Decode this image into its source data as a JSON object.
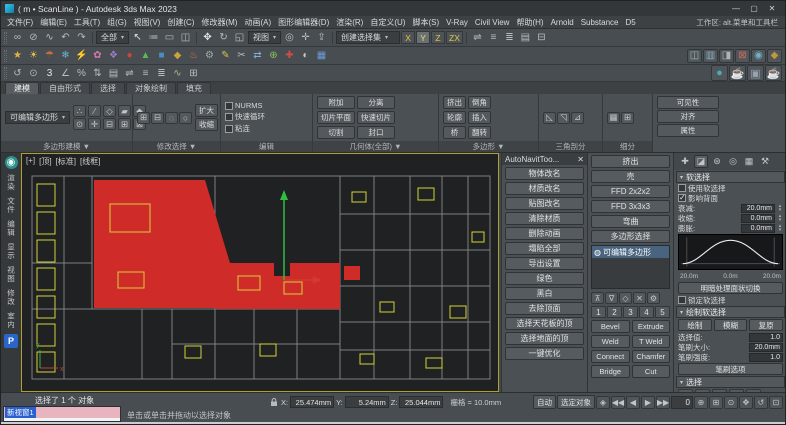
{
  "colors": {
    "accent_red": "#cf2b28",
    "accent_yellow": "#d6d23a",
    "viewport_bg": "#1f2123",
    "selection_blue": "#2a5fd0"
  },
  "window": {
    "title": "( m • ScanLine ) - Autodesk 3ds Max 2023",
    "controls": {
      "min": "—",
      "max": "▢",
      "close": "✕"
    }
  },
  "menubar": {
    "items": [
      "文件(F)",
      "编辑(E)",
      "工具(T)",
      "组(G)",
      "视图(V)",
      "创建(C)",
      "修改器(M)",
      "动画(A)",
      "图形编辑器(D)",
      "渲染(R)",
      "自定义(U)",
      "脚本(S)",
      "V-Ray",
      "Civil View",
      "帮助(H)",
      "Arnold",
      "Substance",
      "D5"
    ],
    "workspace": "工作区: alt.菜单和工具栏"
  },
  "toolbar1": {
    "left_icons": [
      {
        "n": "select-and-link-icon",
        "g": "∞",
        "c": "#b8bcbe"
      },
      {
        "n": "unlink-selection-icon",
        "g": "⊘",
        "c": "#b8bcbe"
      },
      {
        "n": "bind-to-spacewarp-icon",
        "g": "∿",
        "c": "#b8bcbe"
      },
      {
        "n": "undo-icon",
        "g": "↶",
        "c": "#b8bcbe"
      },
      {
        "n": "redo-icon",
        "g": "↷",
        "c": "#b8bcbe"
      }
    ],
    "filter": "全部",
    "select_icons": [
      {
        "n": "select-object-icon",
        "g": "↖",
        "c": "#e0e2e3"
      },
      {
        "n": "select-by-name-icon",
        "g": "≔",
        "c": "#b8bcbe"
      },
      {
        "n": "rect-selection-region-icon",
        "g": "▭",
        "c": "#b8bcbe"
      },
      {
        "n": "window-crossing-icon",
        "g": "◫",
        "c": "#b8bcbe"
      }
    ],
    "transform_icons": [
      {
        "n": "select-and-move-icon",
        "g": "✥",
        "c": "#e0e2e3"
      },
      {
        "n": "select-and-rotate-icon",
        "g": "↻",
        "c": "#b8bcbe"
      },
      {
        "n": "select-and-scale-icon",
        "g": "◱",
        "c": "#b8bcbe"
      }
    ],
    "refcoord": "视图",
    "pivot_icons": [
      {
        "n": "use-pivot-center-icon",
        "g": "◎",
        "c": "#b8bcbe"
      },
      {
        "n": "select-and-manipulate-icon",
        "g": "✛",
        "c": "#b8bcbe"
      },
      {
        "n": "keyboard-override-icon",
        "g": "⇪",
        "c": "#b8bcbe"
      }
    ],
    "named_sets": "创建选择集",
    "axis": [
      {
        "label": "X"
      },
      {
        "label": "Y",
        "cls": "on"
      },
      {
        "label": "Z"
      },
      {
        "label": "ZX"
      }
    ],
    "right_icons": [
      {
        "n": "mirror-icon",
        "g": "⇌",
        "c": "#b8bcbe"
      },
      {
        "n": "align-icon",
        "g": "≡",
        "c": "#b8bcbe"
      },
      {
        "n": "layer-manager-icon",
        "g": "≣",
        "c": "#b8bcbe"
      },
      {
        "n": "ribbon-toggle-icon",
        "g": "▤",
        "c": "#b8bcbe"
      },
      {
        "n": "scene-explorer-icon",
        "g": "⊟",
        "c": "#b8bcbe"
      }
    ]
  },
  "toolbar2": {
    "icons": [
      {
        "n": "star-tool-icon",
        "g": "★",
        "c": "#e0b340"
      },
      {
        "n": "sun-tool-icon",
        "g": "☀",
        "c": "#e6c84c"
      },
      {
        "n": "umbrella-tool-icon",
        "g": "☂",
        "c": "#d06a3c"
      },
      {
        "n": "snowflake-tool-icon",
        "g": "❄",
        "c": "#6cb6da"
      },
      {
        "n": "lightning-tool-icon",
        "g": "⚡",
        "c": "#e8d44e"
      },
      {
        "n": "flower-tool-icon",
        "g": "✿",
        "c": "#d878a8"
      },
      {
        "n": "ornament-tool-icon",
        "g": "❖",
        "c": "#9c7ccc"
      },
      {
        "n": "circle-tool-icon",
        "g": "●",
        "c": "#cc4538"
      },
      {
        "n": "triangle-tool-icon",
        "g": "▲",
        "c": "#5aba5a"
      },
      {
        "n": "square-tool-icon",
        "g": "■",
        "c": "#4c8aca"
      },
      {
        "n": "diamond-tool-icon",
        "g": "◆",
        "c": "#c8a23c"
      },
      {
        "n": "hotspring-tool-icon",
        "g": "♨",
        "c": "#d87a4a"
      },
      {
        "n": "gear-tool-icon",
        "g": "⚙",
        "c": "#a2a8ac"
      },
      {
        "n": "pencil-tool-icon",
        "g": "✎",
        "c": "#d8c24c"
      },
      {
        "n": "scissors-tool-icon",
        "g": "✂",
        "c": "#b8bcbf"
      },
      {
        "n": "swap-arrows-tool-icon",
        "g": "⇄",
        "c": "#7cb2da"
      },
      {
        "n": "plus-circle-tool-icon",
        "g": "⊕",
        "c": "#8ac25a"
      },
      {
        "n": "plus-tool-icon",
        "g": "✚",
        "c": "#d24a4a"
      },
      {
        "n": "half-circle-tool-icon",
        "g": "◐",
        "c": "#c9c9c9"
      },
      {
        "n": "grid-tool-icon",
        "g": "▦",
        "c": "#6c9cda"
      }
    ],
    "right_icons": [
      {
        "n": "panel-a-icon",
        "g": "◫",
        "c": "#9ab0bc"
      },
      {
        "n": "panel-b-icon",
        "g": "▥",
        "c": "#8aaec0"
      },
      {
        "n": "panel-c-icon",
        "g": "◨",
        "c": "#aab4ba"
      },
      {
        "n": "panel-d-icon",
        "g": "⊠",
        "c": "#cc6a5a"
      },
      {
        "n": "panel-e-icon",
        "g": "◉",
        "c": "#6cb4c8"
      },
      {
        "n": "panel-f-icon",
        "g": "◆",
        "c": "#c09a3a"
      }
    ]
  },
  "toolbar3": {
    "left_icons": [
      {
        "n": "arc-rotate-icon",
        "g": "↺",
        "c": "#b8bcbe"
      },
      {
        "n": "isolate-selection-icon",
        "g": "⊙",
        "c": "#b8bcbe"
      },
      {
        "n": "snap-toggle-3d-icon",
        "g": "3",
        "c": "#e4e5e6"
      },
      {
        "n": "angle-snap-icon",
        "g": "∠",
        "c": "#b8bcbe"
      },
      {
        "n": "percent-snap-icon",
        "g": "%",
        "c": "#b8bcbe"
      },
      {
        "n": "spinner-snap-icon",
        "g": "⇅",
        "c": "#b8bcbe"
      },
      {
        "n": "edit-named-sets-icon",
        "g": "▤",
        "c": "#b8bcbe"
      },
      {
        "n": "mirror-tool-icon",
        "g": "⇌",
        "c": "#b8bcbe"
      },
      {
        "n": "align-tool-icon",
        "g": "≡",
        "c": "#b8bcbe"
      },
      {
        "n": "layer-explorer-icon",
        "g": "≣",
        "c": "#b8bcbe"
      },
      {
        "n": "curve-editor-icon",
        "g": "∿",
        "c": "#9cc27c"
      },
      {
        "n": "schematic-view-icon",
        "g": "⊞",
        "c": "#b8bcbe"
      }
    ],
    "right_icons": [
      {
        "n": "material-editor-icon",
        "g": "●",
        "c": "#46aab8"
      },
      {
        "n": "render-setup-icon",
        "g": "☕",
        "c": "#7cb6ca"
      },
      {
        "n": "rendered-frame-icon",
        "g": "▣",
        "c": "#96a2ac"
      },
      {
        "n": "render-production-icon",
        "g": "☕",
        "c": "#5c9aca"
      }
    ]
  },
  "ribbon": {
    "tabs": [
      {
        "label": "建模",
        "cls": "active"
      },
      {
        "label": "自由形式"
      },
      {
        "label": "选择"
      },
      {
        "label": "对象绘制"
      },
      {
        "label": "填充"
      }
    ],
    "poly_modeling": {
      "dropdown": "可编辑多边形",
      "icons": [
        {
          "n": "vertex-subobject-icon",
          "g": "∴"
        },
        {
          "n": "edge-subobject-icon",
          "g": "∕"
        },
        {
          "n": "border-subobject-icon",
          "g": "◇"
        },
        {
          "n": "polygon-subobject-icon",
          "g": "▰"
        },
        {
          "n": "element-subobject-icon",
          "g": "◆"
        },
        {
          "n": "preview-subobject-icon",
          "g": "⊙"
        },
        {
          "n": "pivot-toggle-icon",
          "g": "✛"
        },
        {
          "n": "collapse-icon",
          "g": "⊟"
        },
        {
          "n": "attach-small-icon",
          "g": "⊞"
        },
        {
          "n": "detach-small-icon",
          "g": "⊠"
        }
      ],
      "footer": "多边形建模 ▼"
    },
    "modify_selection": {
      "icons": [
        {
          "n": "grow-selection-icon",
          "g": "⊞"
        },
        {
          "n": "shrink-selection-icon",
          "g": "⊟"
        },
        {
          "n": "loop-selection-icon",
          "g": "◌"
        },
        {
          "n": "ring-selection-icon",
          "g": "○"
        }
      ],
      "buttons": [
        "扩大",
        "收缩"
      ],
      "footer": "修改选择 ▼"
    },
    "edit": {
      "toggles": [
        "NURMS",
        "快速循环",
        "粘连"
      ],
      "footer": "编辑"
    },
    "geometry": {
      "buttons": [
        "附加",
        "分离",
        "切片平面",
        "快速切片",
        "切割",
        "封口"
      ],
      "footer": "几何体(全部) ▼"
    },
    "polygons": {
      "buttons": [
        "挤出",
        "倒角",
        "轮廓",
        "插入",
        "桥",
        "翻转"
      ],
      "footer": "多边形 ▼"
    },
    "triangulation": {
      "icons": [
        {
          "n": "triangulate-icon",
          "g": "◺"
        },
        {
          "n": "retriangulate-icon",
          "g": "◹"
        },
        {
          "n": "edit-triangulation-icon",
          "g": "⊿"
        }
      ],
      "footer": "三角剖分"
    },
    "subdivision": {
      "icons": [
        {
          "n": "meshsmooth-icon",
          "g": "▦"
        },
        {
          "n": "tessellate-icon",
          "g": "⊞"
        }
      ],
      "footer": "细分"
    },
    "right_buttons": [
      "可见性",
      "对齐",
      "属性"
    ]
  },
  "left_dock": {
    "labels": [
      "渲染",
      "文件",
      "编辑",
      "显示",
      "视图",
      "修改",
      "室内"
    ],
    "p_badge": "P"
  },
  "viewport": {
    "menus": [
      "[+]",
      "[顶]",
      "[标准]",
      "[线框]"
    ],
    "axis_x": "x",
    "axis_y": "y"
  },
  "plugin_panel": {
    "title": "AutoNavitToo...",
    "buttons": [
      "物体改名",
      "材质改名",
      "贴图改名",
      "清除材质",
      "删除动画",
      "塌陷全部",
      "导出设置",
      "绿色",
      "黑白",
      "去除顶面",
      "选择天花板的顶",
      "选择地面的顶",
      "一键优化"
    ]
  },
  "modifier_panel": {
    "buttons": [
      "挤出",
      "壳",
      "FFD 2x2x2",
      "FFD 3x3x3",
      "弯曲",
      "多边形选择"
    ],
    "bulb": "◍",
    "stack_item": "可编辑多边形",
    "stack_tools": [
      {
        "n": "pin-stack-icon",
        "g": "⊼"
      },
      {
        "n": "show-end-result-icon",
        "g": "∇"
      },
      {
        "n": "make-unique-icon",
        "g": "◇"
      },
      {
        "n": "remove-modifier-icon",
        "g": "✕"
      },
      {
        "n": "configure-sets-icon",
        "g": "⚙"
      }
    ],
    "levels": [
      "1",
      "2",
      "3",
      "4",
      "5"
    ],
    "pairs": [
      {
        "a": "Bevel",
        "b": "Extrude"
      },
      {
        "a": "Weld",
        "b": "T Weld"
      },
      {
        "a": "Connect",
        "b": "Chamfer"
      },
      {
        "a": "Bridge",
        "b": "Cut"
      }
    ]
  },
  "command_panel": {
    "tabs": [
      {
        "n": "create-tab-icon",
        "g": "✚"
      },
      {
        "n": "modify-tab-icon",
        "g": "◪",
        "cls": "active"
      },
      {
        "n": "hierarchy-tab-icon",
        "g": "⊛"
      },
      {
        "n": "motion-tab-icon",
        "g": "◎"
      },
      {
        "n": "display-tab-icon",
        "g": "▦"
      },
      {
        "n": "utilities-tab-icon",
        "g": "⚒"
      }
    ],
    "soft_selection": {
      "header": "软选择",
      "use": "使用软选择",
      "affect_backfacing": "影响背面",
      "falloff_label": "衰减:",
      "falloff": "20.0mm",
      "pinch_label": "收缩:",
      "pinch": "0.0mm",
      "bubble_label": "膨胀:",
      "bubble": "0.0mm",
      "scale_labels": [
        "20.0m",
        "0.0m",
        "20.0m"
      ],
      "shaded_button": "明暗处理面状切换",
      "lock": "锁定软选择"
    },
    "paint": {
      "header": "绘制软选择",
      "buttons": [
        "绘制",
        "模糊",
        "复原"
      ],
      "sel_label": "选择值:",
      "sel": "1.0",
      "size_label": "笔刷大小:",
      "size": "20.0mm",
      "strength_label": "笔刷强度:",
      "strength": "1.0",
      "options": "笔刷选项"
    },
    "selection": {
      "header": "选择",
      "icons": [
        {
          "n": "vertex-level-icon",
          "g": "∴"
        },
        {
          "n": "edge-level-icon",
          "g": "∕"
        },
        {
          "n": "border-level-icon",
          "g": "◇"
        },
        {
          "n": "polygon-level-icon",
          "g": "▰"
        },
        {
          "n": "element-level-icon",
          "g": "◆"
        }
      ]
    }
  },
  "status": {
    "listener_selected": "新视窗1",
    "line1": "选择了 1 个 对象",
    "line2": "单击或单击并拖动以选择对象",
    "x_label": "X:",
    "x": "25.474mm",
    "y_label": "Y:",
    "y": "5.24mm",
    "z_label": "Z:",
    "z": "25.044mm",
    "grid": "栅格 = 10.0mm",
    "auto": "自动",
    "sel_mode": "选定对象",
    "key_icon": "◈",
    "time": "0",
    "playback": [
      {
        "n": "go-to-start-icon",
        "g": "◀◀"
      },
      {
        "n": "previous-frame-icon",
        "g": "◀"
      },
      {
        "n": "play-icon",
        "g": "▶"
      },
      {
        "n": "go-to-end-icon",
        "g": "▶▶"
      }
    ],
    "nav": [
      {
        "n": "zoom-icon",
        "g": "⊕"
      },
      {
        "n": "zoom-all-icon",
        "g": "⊞"
      },
      {
        "n": "zoom-extents-icon",
        "g": "⊙"
      },
      {
        "n": "pan-icon",
        "g": "✥"
      },
      {
        "n": "orbit-icon",
        "g": "↺"
      },
      {
        "n": "maximize-viewport-icon",
        "g": "⊡"
      }
    ]
  }
}
